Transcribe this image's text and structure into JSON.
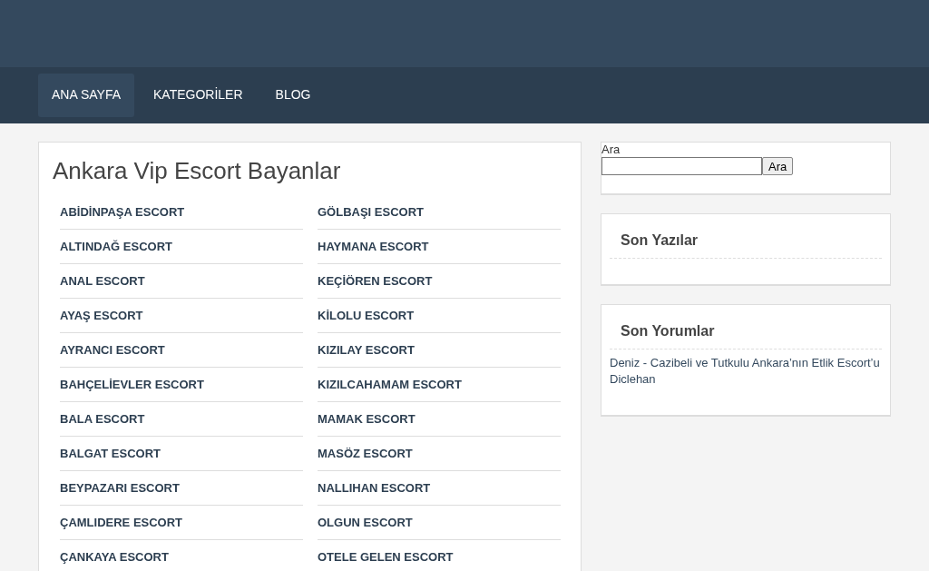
{
  "nav": [
    {
      "label": "ANA SAYFA",
      "selected": true
    },
    {
      "label": "KATEGORİLER",
      "selected": false
    },
    {
      "label": "BLOG",
      "selected": false
    }
  ],
  "main": {
    "title": "Ankara Vip Escort Bayanlar",
    "links": [
      [
        "ABİDİNPAŞA ESCORT",
        "GÖLBAŞI ESCORT"
      ],
      [
        "ALTINDAĞ ESCORT",
        "HAYMANA ESCORT"
      ],
      [
        "ANAL ESCORT",
        "KEÇİÖREN ESCORT"
      ],
      [
        "AYAŞ ESCORT",
        "KİLOLU ESCORT"
      ],
      [
        "AYRANCI ESCORT",
        "KIZILAY ESCORT"
      ],
      [
        "BAHÇELİEVLER ESCORT",
        "KIZILCAHAMAM ESCORT"
      ],
      [
        "BALA ESCORT",
        "MAMAK ESCORT"
      ],
      [
        "BALGAT ESCORT",
        "MASÖZ ESCORT"
      ],
      [
        "BEYPAZARI ESCORT",
        "NALLIHAN ESCORT"
      ],
      [
        "ÇAMLIDERE ESCORT",
        "OLGUN ESCORT"
      ],
      [
        "ÇANKAYA ESCORT",
        "OTELE GELEN ESCORT"
      ]
    ]
  },
  "sidebar": {
    "search": {
      "label": "Ara",
      "button": "Ara"
    },
    "widgets": [
      {
        "title": "Son Yazılar"
      },
      {
        "title": "Son Yorumlar",
        "comments": [
          {
            "text": "Deniz - Cazibeli ve Tutkulu Ankara’nın Etlik Escort’u Diclehan"
          }
        ]
      }
    ]
  }
}
